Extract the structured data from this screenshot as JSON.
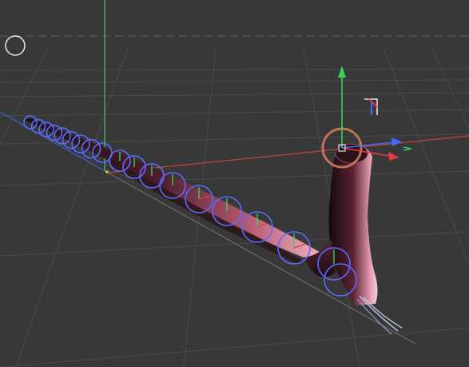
{
  "viewport": {
    "mode": "perspective",
    "background": "#383838",
    "grid": {
      "visible": true,
      "line_color": "#4a4a4a",
      "horizon_dash_color": "#5a5a5a"
    },
    "world_axes": {
      "x_color": "#c84040",
      "y_color": "#3ec46a",
      "z_color": "#3c5fcf"
    }
  },
  "scene": {
    "object": {
      "type": "tube / sweep mesh",
      "color": "#d8879a",
      "shadow_color": "#2a1a1e",
      "spline_ring_count": 27,
      "ring_color": "#5a6cff"
    },
    "gizmo": {
      "type": "move/rotate",
      "x_color": "#e43c3c",
      "y_color": "#35d35a",
      "z_color": "#3f6bff",
      "rotate_ring_color": "#d07a5a"
    },
    "icons": [
      "view-options-circle-icon",
      "axis-orientation-icon"
    ]
  }
}
